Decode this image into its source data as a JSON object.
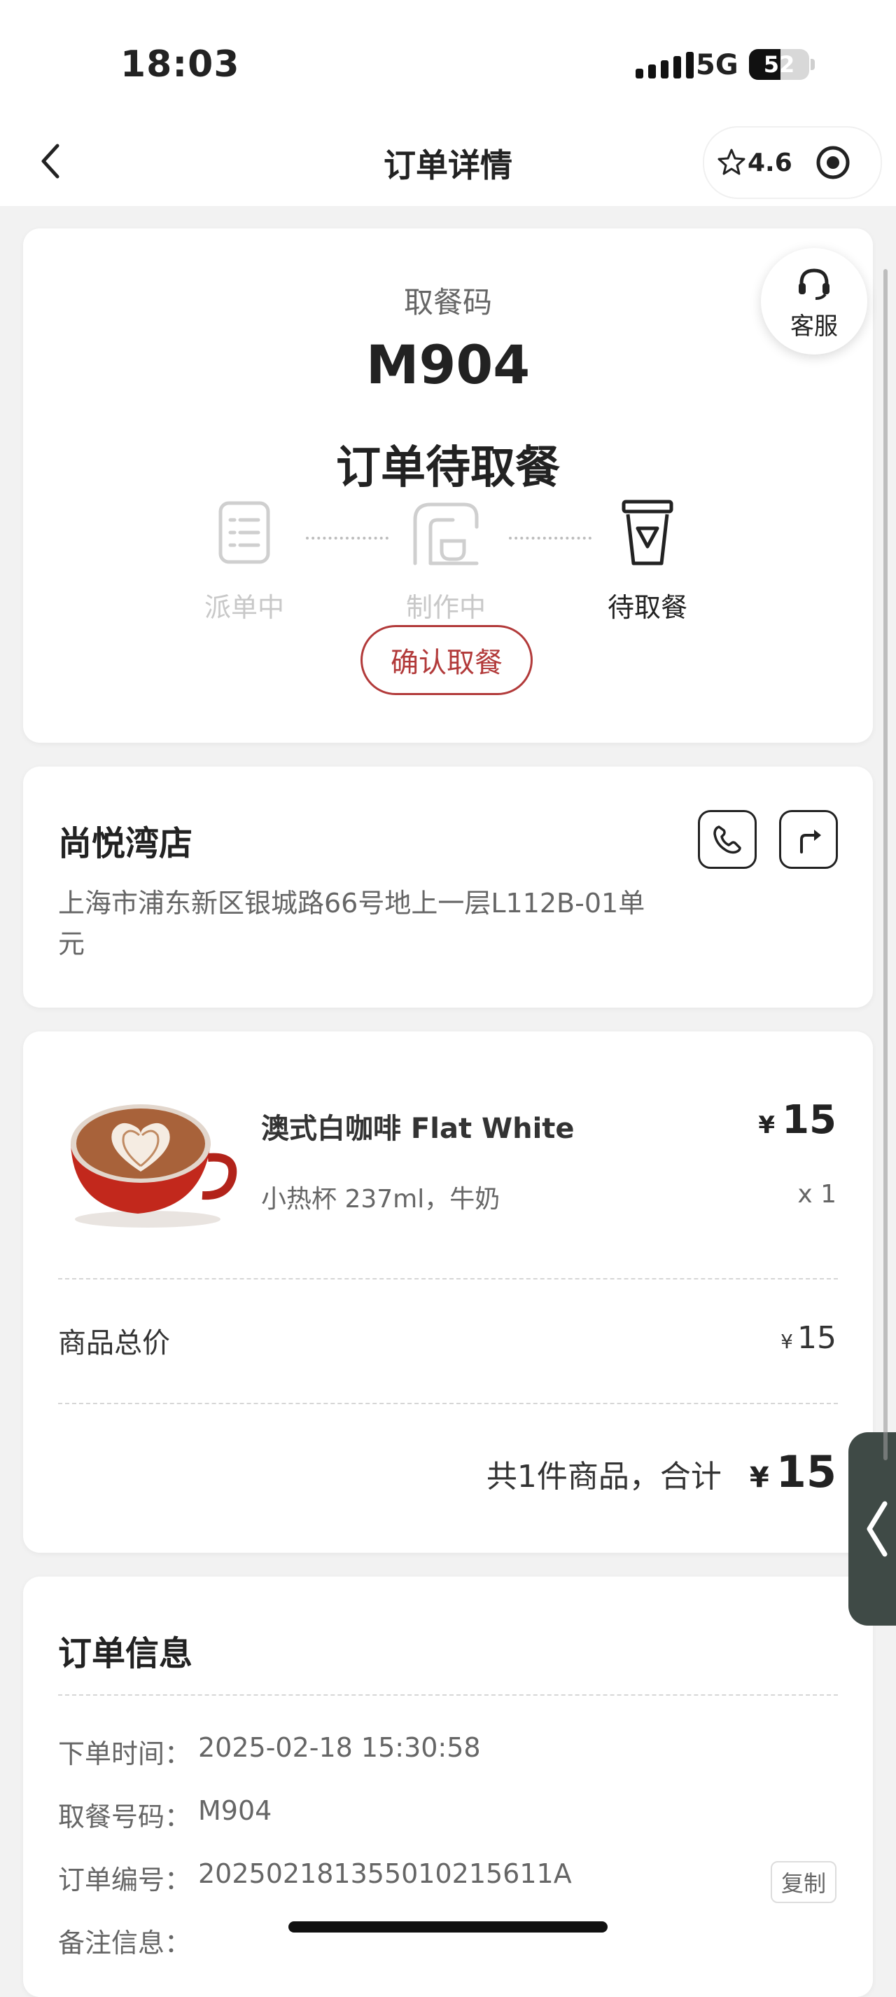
{
  "status_bar": {
    "time": "18:03",
    "network": "5G",
    "battery_level": "52"
  },
  "header": {
    "title": "订单详情",
    "rating": "4.6"
  },
  "customer_service": {
    "label": "客服"
  },
  "pickup": {
    "label": "取餐码",
    "code": "M904",
    "status": "订单待取餐"
  },
  "progress_steps": [
    {
      "label": "派单中",
      "state": "done",
      "icon": "list-icon"
    },
    {
      "label": "制作中",
      "state": "done",
      "icon": "coffee-machine-icon"
    },
    {
      "label": "待取餐",
      "state": "current",
      "icon": "cup-icon"
    }
  ],
  "confirm_button": {
    "label": "确认取餐"
  },
  "store": {
    "name": "尚悦湾店",
    "address": "上海市浦东新区银城路66号地上一层L112B-01单元",
    "actions": [
      "phone-icon",
      "directions-icon"
    ]
  },
  "order_items": [
    {
      "name": "澳式白咖啡 Flat White",
      "spec": "小热杯 237ml，牛奶",
      "currency": "¥",
      "price": "15",
      "quantity": "x 1",
      "image": "flat-white-coffee-cup"
    }
  ],
  "summary": {
    "subtotal_label": "商品总价",
    "subtotal_currency": "¥",
    "subtotal_value": "15",
    "total_text": "共1件商品，合计",
    "total_currency": "¥",
    "total_value": "15"
  },
  "order_info": {
    "title": "订单信息",
    "rows": [
      {
        "label": "下单时间：",
        "value": "2025-02-18 15:30:58"
      },
      {
        "label": "取餐号码：",
        "value": "M904"
      },
      {
        "label": "订单编号：",
        "value": "20250218135501021561​1A"
      },
      {
        "label": "备注信息：",
        "value": ""
      }
    ],
    "copy_label": "复制"
  },
  "colors": {
    "accent": "#b23a3a",
    "muted_step": "#c8c8c8",
    "side_tab": "#3f4a46"
  }
}
